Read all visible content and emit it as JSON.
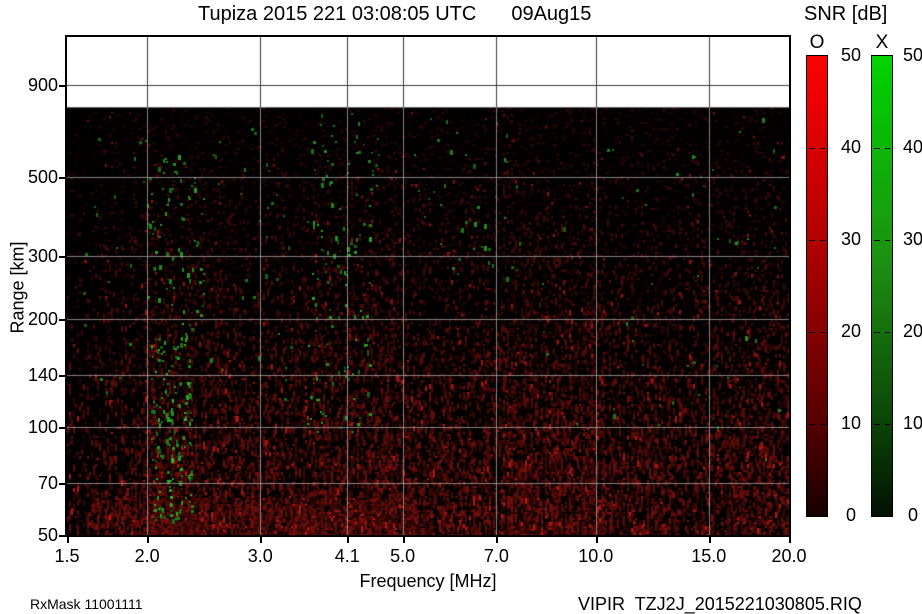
{
  "header": {
    "title": "Tupiza 2015 221 03:08:05 UTC",
    "date": "09Aug15"
  },
  "legend": {
    "title": "SNR [dB]",
    "o": {
      "label": "O",
      "color": "#ff0000",
      "gradient": [
        "#ff0000",
        "#a80000",
        "#560000",
        "#160000"
      ],
      "ticks": [
        "50",
        "40",
        "30",
        "20",
        "10",
        "0"
      ]
    },
    "x": {
      "label": "X",
      "color": "#00d400",
      "gradient": [
        "#00d400",
        "#1d8f12",
        "#0b4407",
        "#041103"
      ],
      "ticks": [
        "50",
        "40",
        "30",
        "20",
        "10",
        "0"
      ]
    }
  },
  "axes": {
    "x_label": "Frequency [MHz]",
    "y_label": "Range [km]",
    "x_ticks": [
      {
        "v": 1.5,
        "label": "1.5"
      },
      {
        "v": 2.0,
        "label": "2.0"
      },
      {
        "v": 3.0,
        "label": "3.0"
      },
      {
        "v": 4.1,
        "label": "4.1"
      },
      {
        "v": 5.0,
        "label": "5.0"
      },
      {
        "v": 7.0,
        "label": "7.0"
      },
      {
        "v": 10.0,
        "label": "10.0"
      },
      {
        "v": 15.0,
        "label": "15.0"
      },
      {
        "v": 20.0,
        "label": "20.0"
      }
    ],
    "y_ticks": [
      {
        "v": 50,
        "label": "50"
      },
      {
        "v": 70,
        "label": "70"
      },
      {
        "v": 100,
        "label": "100"
      },
      {
        "v": 140,
        "label": "140"
      },
      {
        "v": 200,
        "label": "200"
      },
      {
        "v": 300,
        "label": "300"
      },
      {
        "v": 500,
        "label": "500"
      },
      {
        "v": 900,
        "label": "900"
      }
    ]
  },
  "footer": {
    "left": "RxMask 11001111",
    "right": "VIPIR  TZJ2J_2015221030805.RIQ"
  },
  "chart_data": {
    "type": "heatmap",
    "title": "Tupiza 2015 221 03:08:05 UTC 09Aug15",
    "xlabel": "Frequency [MHz]",
    "ylabel": "Range [km]",
    "x_scale": "log",
    "y_scale": "log",
    "xlim": [
      1.5,
      20
    ],
    "ylim": [
      50,
      1226
    ],
    "data_top_km": 780,
    "background": "#020000",
    "grid": true,
    "colorbar": {
      "label": "SNR [dB]",
      "range": [
        0,
        50
      ],
      "channels": [
        "O (red)",
        "X (green)"
      ]
    },
    "noise_base": 0.3,
    "noise_bands": [
      {
        "f": 2.15,
        "w": 0.055,
        "a": 0.5
      },
      {
        "f": 2.8,
        "w": 0.08,
        "a": 0.25
      },
      {
        "f": 3.9,
        "w": 0.09,
        "a": 0.35
      },
      {
        "f": 4.7,
        "w": 0.06,
        "a": 0.25
      },
      {
        "f": 6.9,
        "w": 0.08,
        "a": 0.35
      },
      {
        "f": 8.2,
        "w": 0.09,
        "a": 0.2
      },
      {
        "f": 9.7,
        "w": 0.07,
        "a": 0.3
      },
      {
        "f": 12.5,
        "w": 0.1,
        "a": 0.2
      },
      {
        "f": 16.0,
        "w": 0.08,
        "a": 0.25
      },
      {
        "f": 19.2,
        "w": 0.05,
        "a": 0.3
      }
    ],
    "echo_clusters": [
      {
        "f0": 2.02,
        "f1": 2.35,
        "km0": 55,
        "km1": 200,
        "count": 150,
        "bright": 1.0
      },
      {
        "f0": 2.0,
        "f1": 2.45,
        "km0": 200,
        "km1": 600,
        "count": 70,
        "bright": 0.8
      },
      {
        "f0": 3.55,
        "f1": 4.45,
        "km0": 95,
        "km1": 420,
        "count": 90,
        "bright": 0.9
      },
      {
        "f0": 3.6,
        "f1": 4.6,
        "km0": 420,
        "km1": 750,
        "count": 35,
        "bright": 0.7
      },
      {
        "f0": 5.2,
        "f1": 7.6,
        "km0": 260,
        "km1": 740,
        "count": 40,
        "bright": 0.6
      },
      {
        "f0": 7.6,
        "f1": 19.5,
        "km0": 80,
        "km1": 740,
        "count": 48,
        "bright": 0.6
      },
      {
        "f0": 1.55,
        "f1": 2.0,
        "km0": 100,
        "km1": 700,
        "count": 18,
        "bright": 0.5
      },
      {
        "f0": 2.5,
        "f1": 3.5,
        "km0": 120,
        "km1": 700,
        "count": 30,
        "bright": 0.5
      }
    ],
    "description": "VIPIR ionosonde SNR ionogram: dark red receiver noise over black; green X-mode echo speckle concentrated near 2.1-2.3 MHz (55-200 km) and 3.6-4.4 MHz (95-420 km); white band above ~780 km contains no data; gray log-log grid."
  }
}
